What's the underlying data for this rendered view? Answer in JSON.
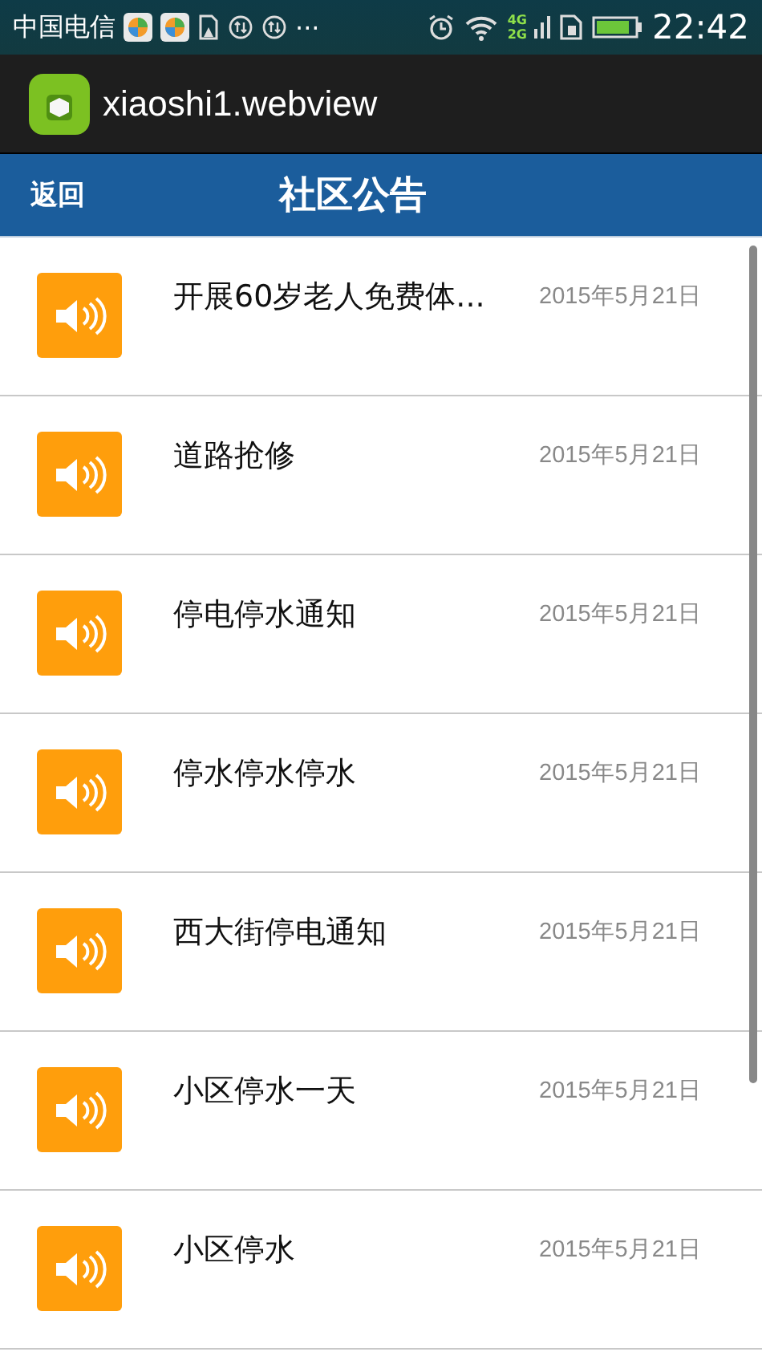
{
  "status_bar": {
    "carrier": "中国电信",
    "more": "···",
    "network": "4G",
    "network_2": "2G",
    "time": "22:42"
  },
  "app_bar": {
    "title": "xiaoshi1.webview"
  },
  "header": {
    "back": "返回",
    "title": "社区公告"
  },
  "notices": [
    {
      "title": "开展60岁老人免费体...",
      "date": "2015年5月21日"
    },
    {
      "title": "道路抢修",
      "date": "2015年5月21日"
    },
    {
      "title": "停电停水通知",
      "date": "2015年5月21日"
    },
    {
      "title": "停水停水停水",
      "date": "2015年5月21日"
    },
    {
      "title": "西大街停电通知",
      "date": "2015年5月21日"
    },
    {
      "title": "小区停水一天",
      "date": "2015年5月21日"
    },
    {
      "title": "小区停水",
      "date": "2015年5月21日"
    }
  ]
}
